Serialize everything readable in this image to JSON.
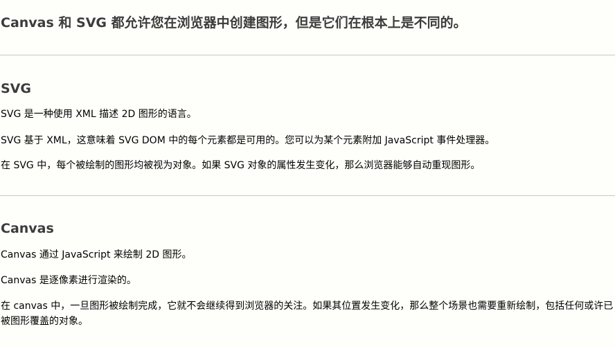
{
  "title": "Canvas 和 SVG 都允许您在浏览器中创建图形，但是它们在根本上是不同的。",
  "sections": [
    {
      "heading": "SVG",
      "paragraphs": [
        "SVG 是一种使用 XML 描述 2D 图形的语言。",
        "SVG 基于 XML，这意味着 SVG DOM 中的每个元素都是可用的。您可以为某个元素附加 JavaScript 事件处理器。",
        "在 SVG 中，每个被绘制的图形均被视为对象。如果 SVG 对象的属性发生变化，那么浏览器能够自动重现图形。"
      ]
    },
    {
      "heading": "Canvas",
      "paragraphs": [
        "Canvas 通过 JavaScript 来绘制 2D 图形。",
        "Canvas 是逐像素进行渲染的。",
        "在 canvas 中，一旦图形被绘制完成，它就不会继续得到浏览器的关注。如果其位置发生变化，那么整个场景也需要重新绘制，包括任何或许已被图形覆盖的对象。"
      ]
    }
  ]
}
